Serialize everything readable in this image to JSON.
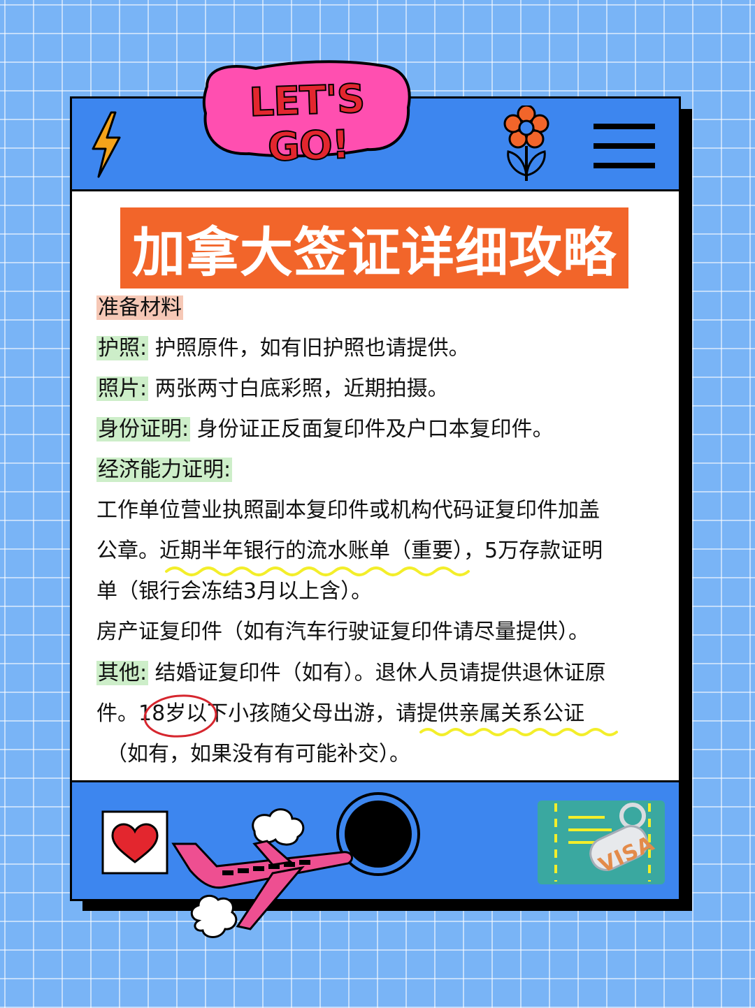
{
  "logo_text": "LET'S GO!",
  "title": "加拿大签证详细攻略",
  "section_heading": "准备材料",
  "items": [
    {
      "label": "护照:",
      "text": "护照原件，如有旧护照也请提供。"
    },
    {
      "label": "照片:",
      "text": "两张两寸白底彩照，近期拍摄。"
    },
    {
      "label": "身份证明:",
      "text": "身份证正反面复印件及户口本复印件。"
    },
    {
      "label": "经济能力证明:",
      "text": ""
    }
  ],
  "finance_lines": [
    "工作单位营业执照副本复印件或机构代码证复印件加盖",
    "公章。近期半年银行的流水账单（重要），5万存款证明",
    "单（银行会冻结3月以上含）。",
    "房产证复印件（如有汽车行驶证复印件请尽量提供）。"
  ],
  "other": {
    "label": "其他:",
    "text": "结婚证复印件（如有）。退休人员请提供退休证原",
    "line2": "件。18岁以下小孩随父母出游，请提供亲属关系公证",
    "line3": "（如有，如果没有有可能补交）。"
  },
  "visa_stamp": "VISA",
  "colors": {
    "background": "#79b4f6",
    "header_blue": "#3d86ef",
    "title_orange": "#f2652a",
    "label_green": "#cdeec9",
    "heading_pink": "#f6c8b6",
    "highlight_yellow": "#f3ee2a",
    "circle_red": "#d6262e"
  },
  "icons": [
    "lightning-icon",
    "flower-icon",
    "hamburger-menu-icon",
    "heart-icon",
    "airplane-icon",
    "cloud-icon",
    "porthole-icon",
    "visa-card-icon"
  ]
}
